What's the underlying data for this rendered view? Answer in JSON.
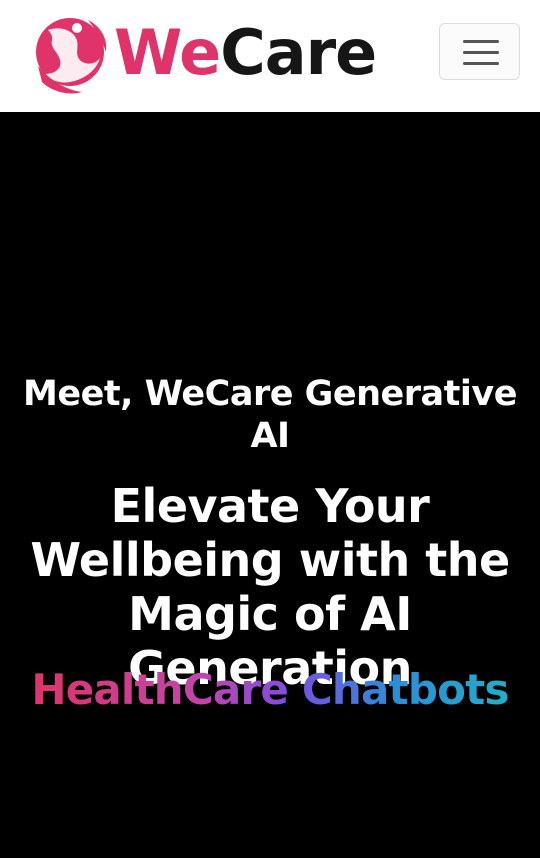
{
  "navbar": {
    "logo": {
      "icon": "wecare-dancer-logo-icon",
      "text_part1": "We",
      "text_part2": "Care"
    },
    "menu_button": {
      "icon": "hamburger-menu-icon"
    }
  },
  "hero": {
    "intro": "Meet, WeCare Generative AI",
    "headline": "Elevate Your Wellbeing with the Magic of AI Generation",
    "highlight": "HealthCare Chatbots"
  },
  "colors": {
    "brand_pink": "#e0336a",
    "brand_dark": "#161616",
    "hero_background": "#000000",
    "gradient_start": "#e0336a",
    "gradient_mid": "#7a4fe0",
    "gradient_end": "#1fb0c8"
  }
}
